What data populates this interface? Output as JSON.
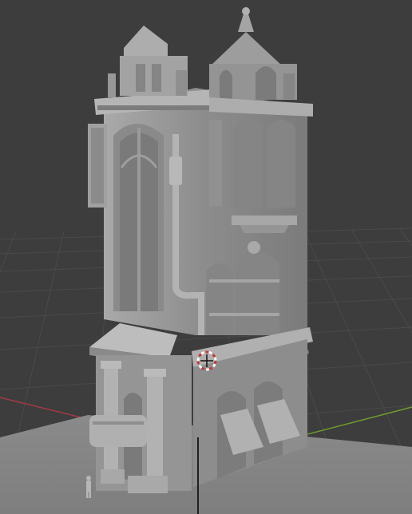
{
  "viewport": {
    "mode": "3d-viewport-solid-shading",
    "background_color": "#3d3d3d",
    "grid_color": "#4a4a4a",
    "x_axis_color": "#a23a45",
    "y_axis_color": "#6f9b2f"
  },
  "scene": {
    "object": "gothic-tower-building",
    "base_color": "#9c9c9c",
    "shadow_color": "#6e6e6e",
    "highlight_color": "#b9b9b9"
  },
  "cursor": {
    "icon": "3d-cursor-icon",
    "ring_color_a": "#c33b3b",
    "ring_color_b": "#ffffff"
  }
}
